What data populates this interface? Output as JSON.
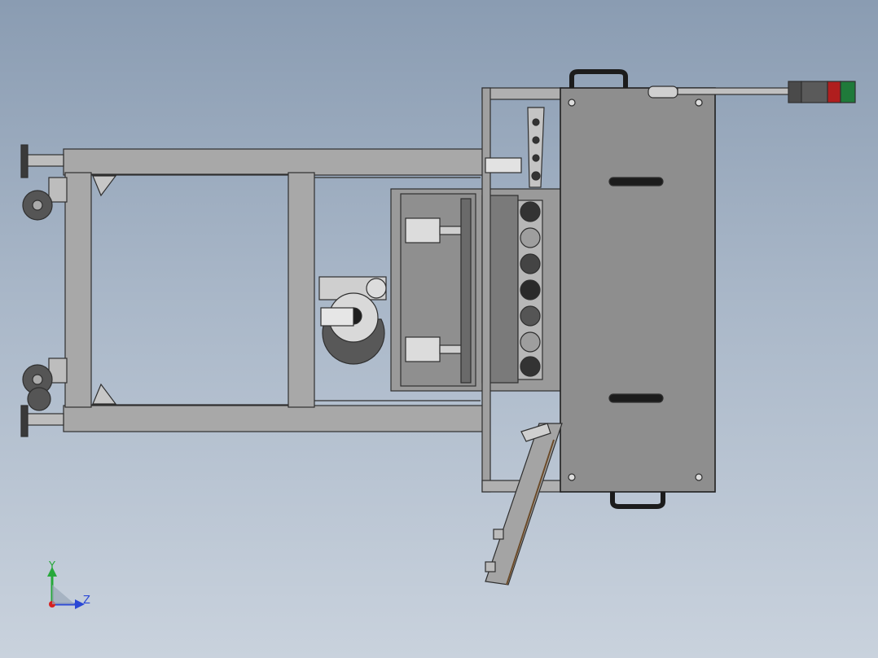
{
  "triad": {
    "y_label": "Y",
    "z_label": "Z",
    "colors": {
      "y": "#27a83a",
      "z": "#2a48d6",
      "x": "#d62020"
    }
  },
  "colors": {
    "background_top": "#8a9cb2",
    "background_bottom": "#c9d2dd",
    "frame": "#a8a8a8",
    "frame_edge": "#2f2f2f",
    "panel": "#8e8e8e",
    "tower_red": "#b01e1e",
    "tower_green": "#1f7a3a"
  }
}
